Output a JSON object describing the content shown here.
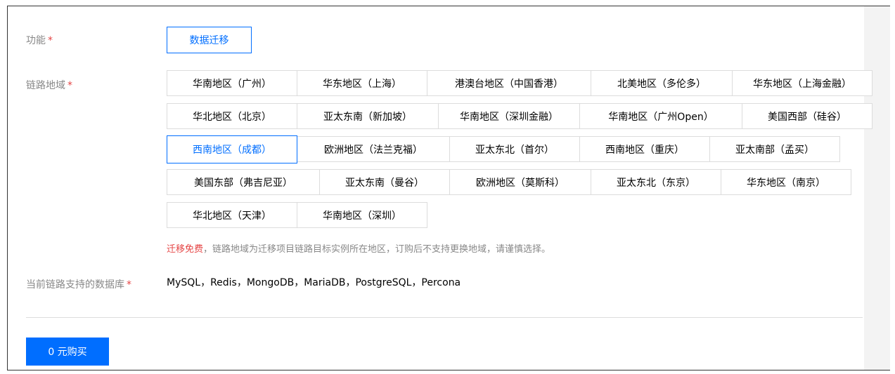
{
  "feature": {
    "label": "功能",
    "required_mark": "*",
    "option": "数据迁移"
  },
  "region": {
    "label": "链路地域",
    "required_mark": "*",
    "rows": [
      [
        "华南地区（广州）",
        "华东地区（上海）",
        "港澳台地区（中国香港）",
        "北美地区（多伦多）",
        "华东地区（上海金融）"
      ],
      [
        "华北地区（北京）",
        "亚太东南（新加坡）",
        "华南地区（深圳金融）",
        "华南地区（广州Open）",
        "美国西部（硅谷）"
      ],
      [
        "西南地区（成都）",
        "欧洲地区（法兰克福）",
        "亚太东北（首尔）",
        "西南地区（重庆）",
        "亚太南部（孟买）"
      ],
      [
        "美国东部（弗吉尼亚）",
        "亚太东南（曼谷）",
        "欧洲地区（莫斯科）",
        "亚太东北（东京）",
        "华东地区（南京）"
      ],
      [
        "华北地区（天津）",
        "华南地区（深圳）"
      ]
    ],
    "selected": "西南地区（成都）",
    "notice_highlight": "迁移免费",
    "notice_text": "，链路地域为迁移项目链路目标实例所在地区，订购后不支持更换地域，请谨慎选择。"
  },
  "databases": {
    "label": "当前链路支持的数据库",
    "required_mark": "*",
    "value": "MySQL，Redis，MongoDB，MariaDB，PostgreSQL，Percona"
  },
  "purchase": {
    "button_label": "0 元购买"
  },
  "colors": {
    "accent": "#006eff",
    "required": "#e54545",
    "label": "#888888"
  }
}
